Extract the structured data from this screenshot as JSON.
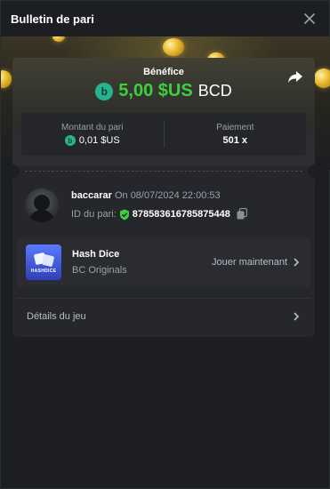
{
  "header": {
    "title": "Bulletin de pari",
    "close_icon": "close-icon"
  },
  "result": {
    "label": "Bénéfice",
    "amount": "5,00 $US",
    "currency": "BCD",
    "amount_color": "#3bd03d"
  },
  "stats": {
    "bet_amount_label": "Montant du pari",
    "bet_amount_value": "0,01 $US",
    "payout_label": "Paiement",
    "payout_value": "501 x"
  },
  "bet": {
    "username": "baccarar",
    "on_label": "On",
    "datetime": "08/07/2024 22:00:53",
    "id_label": "ID du pari:",
    "id_value": "878583616785875448"
  },
  "game": {
    "name": "Hash Dice",
    "provider": "BC Originals",
    "thumb_label": "HASHDICE",
    "play_label": "Jouer maintenant"
  },
  "details": {
    "label": "Détails du jeu"
  },
  "colors": {
    "accent_green": "#3bd03d",
    "coin_teal": "#27b38e",
    "background": "#1c1e22"
  }
}
